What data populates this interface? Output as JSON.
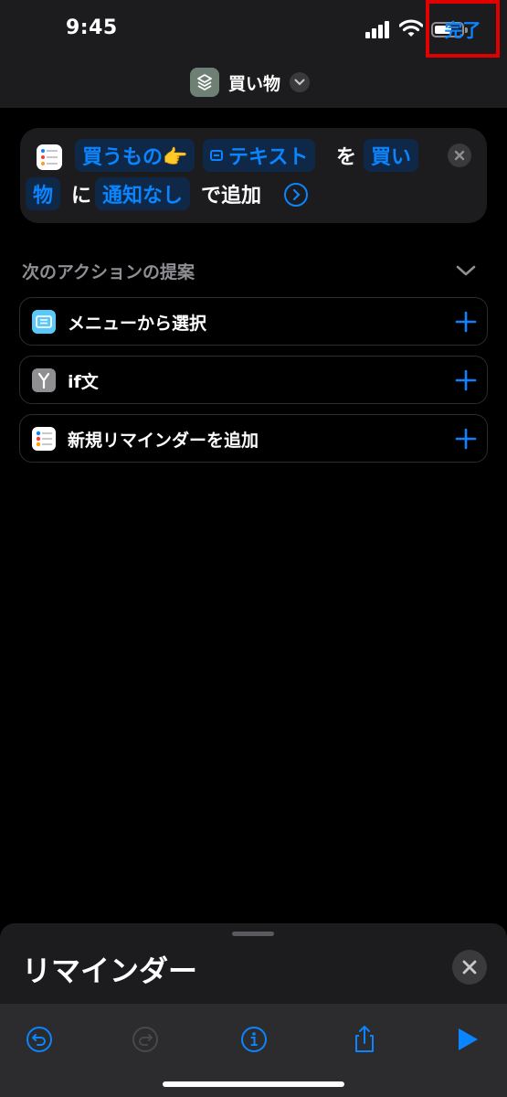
{
  "status_bar": {
    "time": "9:45"
  },
  "nav": {
    "title": "買い物",
    "done_label": "完了"
  },
  "action": {
    "chip_list_var": "買うもの👉",
    "chip_text_var": "テキスト",
    "word_wo": "を",
    "chip_list_line1": "買い",
    "chip_list_line2": "物",
    "word_ni": "に",
    "chip_alert": "通知なし",
    "word_add": "で追加"
  },
  "suggestions": {
    "header": "次のアクションの提案",
    "items": [
      {
        "label": "メニューから選択",
        "icon": "menu-icon"
      },
      {
        "label": "if文",
        "icon": "if-branch-icon"
      },
      {
        "label": "新規リマインダーを追加",
        "icon": "reminders-icon"
      }
    ]
  },
  "sheet": {
    "title": "リマインダー"
  },
  "colors": {
    "accent": "#0a84ff",
    "highlight": "#e00000",
    "background": "#000000",
    "card": "#1c1c1e"
  }
}
